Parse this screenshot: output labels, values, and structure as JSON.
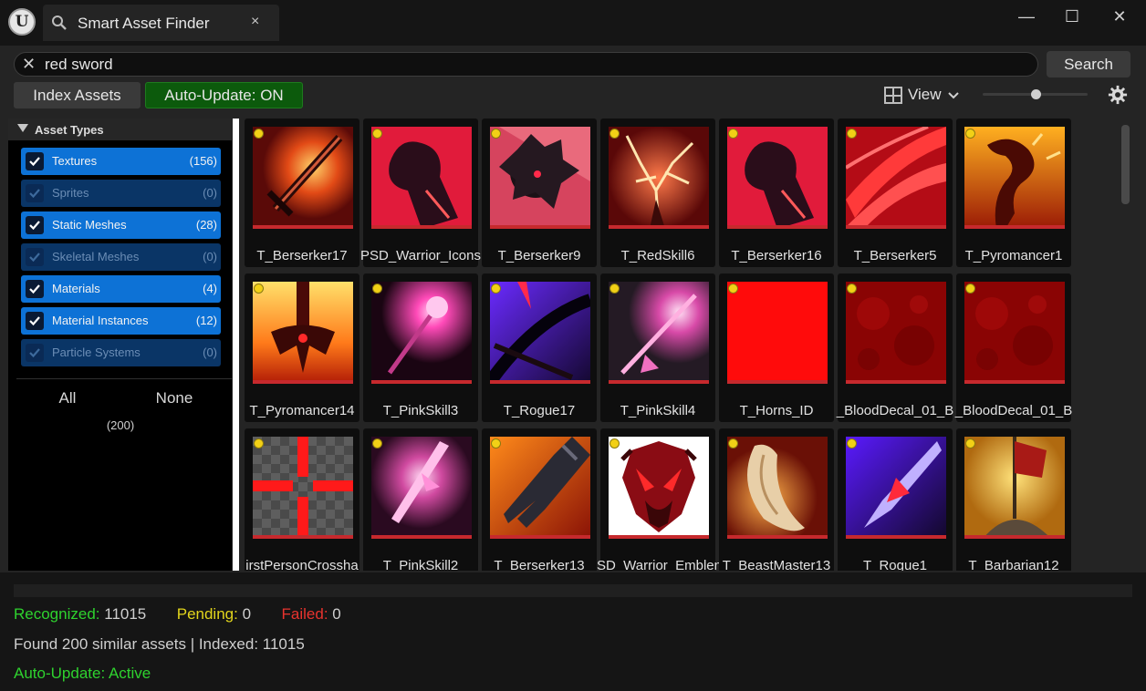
{
  "colors": {
    "recognized": "#2ed22e",
    "pending": "#e2d51c",
    "failed": "#e8332e",
    "type_on": "#0d72d6",
    "type_off": "#0a3566",
    "auto_update_bg": "#0c5a0c",
    "thumb_underline": "#c6292d"
  },
  "window": {
    "logo": "U",
    "tab_title": "Smart Asset Finder",
    "tab_close": "×",
    "minimize": "—",
    "maximize": "☐",
    "close": "✕"
  },
  "search": {
    "clear": "✕",
    "query": "red sword",
    "button_label": "Search"
  },
  "toolbar": {
    "index_label": "Index Assets",
    "auto_update_label": "Auto-Update: ON",
    "view_label": "View",
    "view_chevron": "⌄",
    "thumbnail_size_fraction": 0.5
  },
  "sidebar": {
    "header": "Asset Types",
    "types": [
      {
        "label": "Textures",
        "count": "(156)",
        "checked": true
      },
      {
        "label": "Sprites",
        "count": "(0)",
        "checked": false
      },
      {
        "label": "Static Meshes",
        "count": "(28)",
        "checked": true
      },
      {
        "label": "Skeletal Meshes",
        "count": "(0)",
        "checked": false
      },
      {
        "label": "Materials",
        "count": "(4)",
        "checked": true
      },
      {
        "label": "Material Instances",
        "count": "(12)",
        "checked": true
      },
      {
        "label": "Particle Systems",
        "count": "(0)",
        "checked": false
      }
    ],
    "all_label": "All",
    "none_label": "None",
    "total": "(200)"
  },
  "assets": [
    {
      "name": "T_Berserker17",
      "icon": "flaming-sword-icon"
    },
    {
      "name": "PSD_Warrior_Icons",
      "icon": "red-fist-icon"
    },
    {
      "name": "T_Berserker9",
      "icon": "dark-mace-icon"
    },
    {
      "name": "T_RedSkill6",
      "icon": "lightning-tree-icon"
    },
    {
      "name": "T_Berserker16",
      "icon": "red-fist-icon"
    },
    {
      "name": "T_Berserker5",
      "icon": "red-slash-icon"
    },
    {
      "name": "T_Pyromancer1",
      "icon": "fire-dragon-icon"
    },
    {
      "name": "T_Pyromancer14",
      "icon": "fire-weapon-icon"
    },
    {
      "name": "T_PinkSkill3",
      "icon": "pink-orb-staff-icon"
    },
    {
      "name": "T_Rogue17",
      "icon": "purple-dagger-icon"
    },
    {
      "name": "T_PinkSkill4",
      "icon": "pink-spear-icon"
    },
    {
      "name": "T_Horns_ID",
      "icon": "red-solid-icon"
    },
    {
      "name": "_BloodDecal_01_B",
      "icon": "blood-decal-icon"
    },
    {
      "name": "_BloodDecal_01_B",
      "icon": "blood-decal-icon"
    },
    {
      "name": "irstPersonCrossha",
      "icon": "crosshair-icon"
    },
    {
      "name": "T_PinkSkill2",
      "icon": "pink-crystal-sword-icon"
    },
    {
      "name": "T_Berserker13",
      "icon": "armored-claw-icon"
    },
    {
      "name": "SD_Warrior_Emblen",
      "icon": "demon-shield-icon"
    },
    {
      "name": "T_BeastMaster13",
      "icon": "claw-fang-icon"
    },
    {
      "name": "T_Rogue1",
      "icon": "violet-blade-icon"
    },
    {
      "name": "T_Barbarian12",
      "icon": "battle-banner-icon"
    }
  ],
  "status": {
    "recognized_label": "Recognized:",
    "recognized_value": "11015",
    "pending_label": "Pending:",
    "pending_value": "0",
    "failed_label": "Failed:",
    "failed_value": "0",
    "found_line": "Found 200 similar assets | Indexed: 11015",
    "auto_line": "Auto-Update: Active"
  }
}
